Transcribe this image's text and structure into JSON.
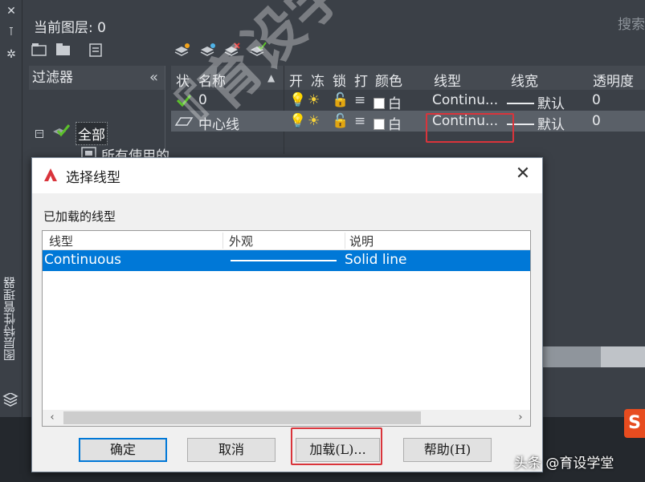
{
  "side_panel": {
    "vertical_title": "图层特性管理器",
    "icons": [
      "close-icon",
      "pin-icon",
      "settings-icon"
    ]
  },
  "layer_manager": {
    "current_layer": "当前图层: 0",
    "search_hint": "搜索",
    "toolbar_icons": [
      "new-property-filter-icon",
      "new-group-filter-icon",
      "layer-states-icon",
      "new-layer-icon",
      "new-layer-vp-frozen-icon",
      "delete-layer-icon",
      "set-current-icon"
    ],
    "filter": {
      "header": "过滤器",
      "collapse": "«",
      "tree_all": "全部",
      "tree_used": "所有使用的"
    },
    "columns": {
      "status": "状",
      "name": "名称",
      "on": "开",
      "freeze": "冻",
      "lock": "锁",
      "plot": "打",
      "color": "颜色",
      "linetype": "线型",
      "lineweight": "线宽",
      "transparency": "透明度"
    },
    "rows": [
      {
        "name": "0",
        "color": "白",
        "linetype": "Continu...",
        "lineweight": "默认",
        "transparency": "0"
      },
      {
        "name": "中心线",
        "color": "白",
        "linetype": "Continu...",
        "lineweight": "默认",
        "transparency": "0"
      }
    ]
  },
  "dialog": {
    "title": "选择线型",
    "loaded_label": "已加载的线型",
    "list_headers": {
      "linetype": "线型",
      "appearance": "外观",
      "description": "说明"
    },
    "list_rows": [
      {
        "linetype": "Continuous",
        "description": "Solid line"
      }
    ],
    "buttons": {
      "ok": "确定",
      "cancel": "取消",
      "load": "加载(L)...",
      "help": "帮助(H)"
    },
    "colors": {
      "selection": "#0078d7",
      "highlight_box": "#d9343b"
    }
  },
  "overlay": {
    "watermark": "『育设学堂』出品",
    "credit": "头条 @育设学堂"
  }
}
